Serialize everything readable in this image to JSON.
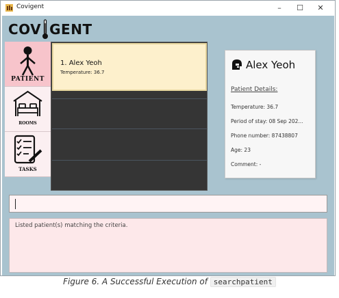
{
  "window": {
    "title": "Covigent",
    "minimize_label": "–",
    "maximize_label": "☐",
    "close_label": "✕"
  },
  "logo": {
    "text_left": "COV",
    "text_right": "GENT"
  },
  "sidebar": {
    "items": [
      {
        "label": "PATIENT",
        "icon": "patient-figure-icon",
        "active": true
      },
      {
        "label": "ROOMS",
        "icon": "bed-room-icon",
        "active": false
      },
      {
        "label": "TASKS",
        "icon": "task-checklist-icon",
        "active": false
      }
    ]
  },
  "patient_list": {
    "items": [
      {
        "index_name": "1.  Alex Yeoh",
        "temperature": "Temperature: 36.7"
      }
    ]
  },
  "patient_detail": {
    "name": "Alex Yeoh",
    "section_title": "Patient Details:",
    "temperature": "Temperature: 36.7",
    "period_of_stay": "Period of stay: 08 Sep 202...",
    "phone": "Phone number: 87438807",
    "age": "Age: 23",
    "comment": "Comment: -"
  },
  "command": {
    "value": ""
  },
  "result": {
    "message": "Listed patient(s) matching the criteria."
  },
  "caption": {
    "text": "Figure 6. A Successful Execution of",
    "code": "searchpatient"
  },
  "colors": {
    "app_background": "#a9c3cf",
    "active_nav": "#f7c4cb",
    "selected_card": "#fdf0cc",
    "list_background": "#353535",
    "result_background": "#fde8ea"
  }
}
